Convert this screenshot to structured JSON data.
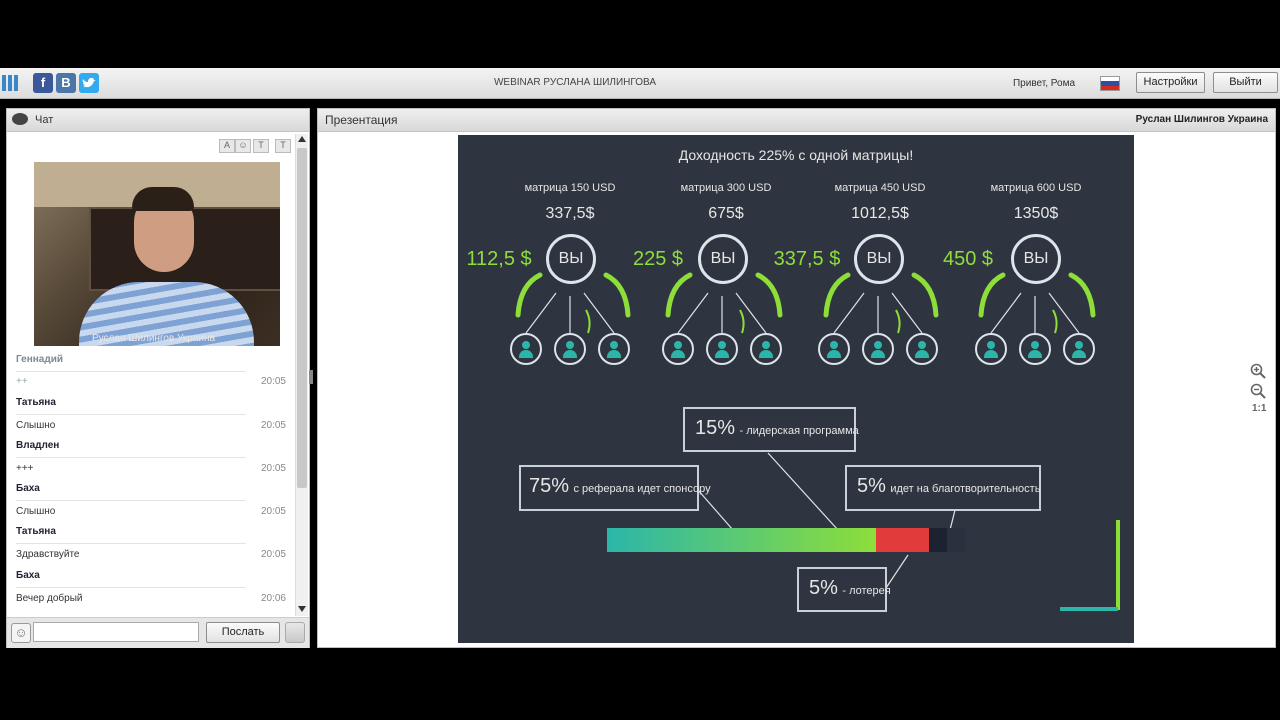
{
  "header": {
    "title": "WEBINAR РУСЛАНА ШИЛИНГОВА",
    "greeting": "Привет, Рома",
    "settings_label": "Настройки",
    "logout_label": "Выйти",
    "social": {
      "facebook": "f",
      "vk": "B"
    }
  },
  "chat": {
    "title": "Чат",
    "video_caption": "Руслан Шилингов Украина",
    "messages": [
      {
        "name": "Геннадий",
        "text": "++",
        "time": "20:05"
      },
      {
        "name": "Татьяна",
        "text": "Слышно",
        "time": "20:05"
      },
      {
        "name": "Владлен",
        "text": "+++",
        "time": "20:05"
      },
      {
        "name": "Баха",
        "text": "Слышно",
        "time": "20:05"
      },
      {
        "name": "Татьяна",
        "text": "Здравствуйте",
        "time": "20:05"
      },
      {
        "name": "Баха",
        "text": "Вечер добрый",
        "time": "20:06"
      }
    ],
    "send_label": "Послать",
    "input_value": ""
  },
  "presentation": {
    "title": "Презентация",
    "presenter": "Руслан Шилингов Украина",
    "zoom_level": "1:1",
    "slide": {
      "heading": "Доходность 225% с одной матрицы!",
      "you_label": "ВЫ",
      "matrices": [
        {
          "label": "матрица 150 USD",
          "total": "337,5$",
          "bonus": "112,5 $"
        },
        {
          "label": "матрица 300 USD",
          "total": "675$",
          "bonus": "225 $"
        },
        {
          "label": "матрица 450 USD",
          "total": "1012,5$",
          "bonus": "337,5 $"
        },
        {
          "label": "матрица 600 USD",
          "total": "1350$",
          "bonus": "450 $"
        }
      ],
      "leader": {
        "pct": "15%",
        "text": "- лидерская программа"
      },
      "referral": {
        "pct": "75%",
        "text": "с реферала идет спонсору"
      },
      "charity": {
        "pct": "5%",
        "text": "идет на благотворительность"
      },
      "lottery": {
        "pct": "5%",
        "text": "- лотерея"
      },
      "bar_shares": [
        75,
        15,
        5,
        5
      ],
      "bar_colors": [
        "#2bb6a9",
        "#8ede3a",
        "#e23b3b",
        "#1d2230",
        "#2a303d"
      ]
    }
  }
}
